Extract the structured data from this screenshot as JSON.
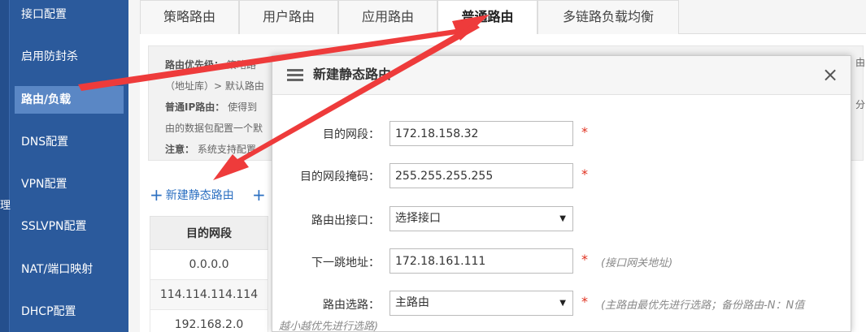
{
  "sidebar": {
    "edge_label": "理",
    "items": [
      {
        "label": "接口配置"
      },
      {
        "label": "启用防封杀"
      },
      {
        "label": "路由/负载"
      },
      {
        "label": "DNS配置"
      },
      {
        "label": "VPN配置"
      },
      {
        "label": "SSLVPN配置"
      },
      {
        "label": "NAT/端口映射"
      },
      {
        "label": "DHCP配置"
      }
    ],
    "active_index": 2
  },
  "tabs": [
    {
      "label": "策略路由"
    },
    {
      "label": "用户路由"
    },
    {
      "label": "应用路由"
    },
    {
      "label": "普通路由"
    },
    {
      "label": "多链路负载均衡"
    }
  ],
  "active_tab": 3,
  "info": {
    "line1_bold": "路由优先级：",
    "line1_text": "策略路",
    "line2_text": "（地址库）> 默认路由",
    "line3_bold": "普通IP路由：",
    "line3_text": "使得到",
    "line4_text": "由的数据包配置一个默",
    "line5_bold": "注意：",
    "line5_text": "系统支持配置",
    "right_frag1": "由",
    "right_frag2": "分"
  },
  "actions": {
    "add_static_route": "新建静态路由",
    "plus_glyph": "+"
  },
  "table": {
    "header": "目的网段",
    "rows": [
      "0.0.0.0",
      "114.114.114.114",
      "192.168.2.0"
    ]
  },
  "modal": {
    "title": "新建静态路由",
    "close_glyph": "×",
    "fields": {
      "dest_label": "目的网段：",
      "dest_value": "172.18.158.32",
      "mask_label": "目的网段掩码：",
      "mask_value": "255.255.255.255",
      "iface_label": "路由出接口：",
      "iface_value": "选择接口",
      "nexthop_label": "下一跳地址：",
      "nexthop_value": "172.18.161.111",
      "nexthop_hint": "(接口网关地址)",
      "route_label": "路由选路：",
      "route_value": "主路由",
      "route_hint": "(主路由最优先进行选路；备份路由-N：N值",
      "route_hint2": "越小越优先进行选路)"
    },
    "required_mark": "*",
    "select_arrow": "▼"
  },
  "colors": {
    "sidebar_bg": "#2b5a9c",
    "sidebar_active": "#5a87c5",
    "link": "#2b6fc1",
    "required": "#e0301e",
    "annotation_arrow": "#ee3b3b"
  }
}
